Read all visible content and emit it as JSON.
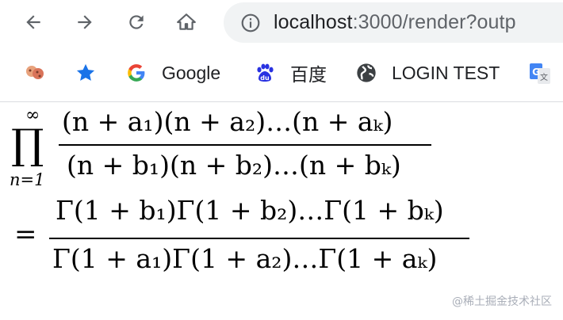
{
  "toolbar": {
    "back_icon": "arrow-left-icon",
    "forward_icon": "arrow-right-icon",
    "reload_icon": "reload-icon",
    "home_icon": "home-icon",
    "url_host": "localhost",
    "url_rest": ":3000/render?outp"
  },
  "bookmarks": [
    {
      "icon": "cookie-icon",
      "label": ""
    },
    {
      "icon": "star-icon",
      "label": ""
    },
    {
      "icon": "google-icon",
      "label": "Google"
    },
    {
      "icon": "baidu-icon",
      "label": "百度"
    },
    {
      "icon": "globe-icon",
      "label": "LOGIN TEST"
    },
    {
      "icon": "translate-icon",
      "label": ""
    }
  ],
  "formula": {
    "prod_symbol": "∏",
    "prod_upper": "∞",
    "prod_lower": "n=1",
    "num1": "(n + a",
    "num1_parts": {
      "line1_numerator": "(n + a₁)(n + a₂)…(n + aₖ)",
      "line1_denominator": "(n + b₁)(n + b₂)…(n + bₖ)",
      "equals": "=",
      "line2_numerator": "Γ(1 + b₁)Γ(1 + b₂)…Γ(1 + bₖ)",
      "line2_denominator": "Γ(1 + a₁)Γ(1 + a₂)…Γ(1 + aₖ)"
    }
  },
  "watermark": "@稀土掘金技术社区"
}
